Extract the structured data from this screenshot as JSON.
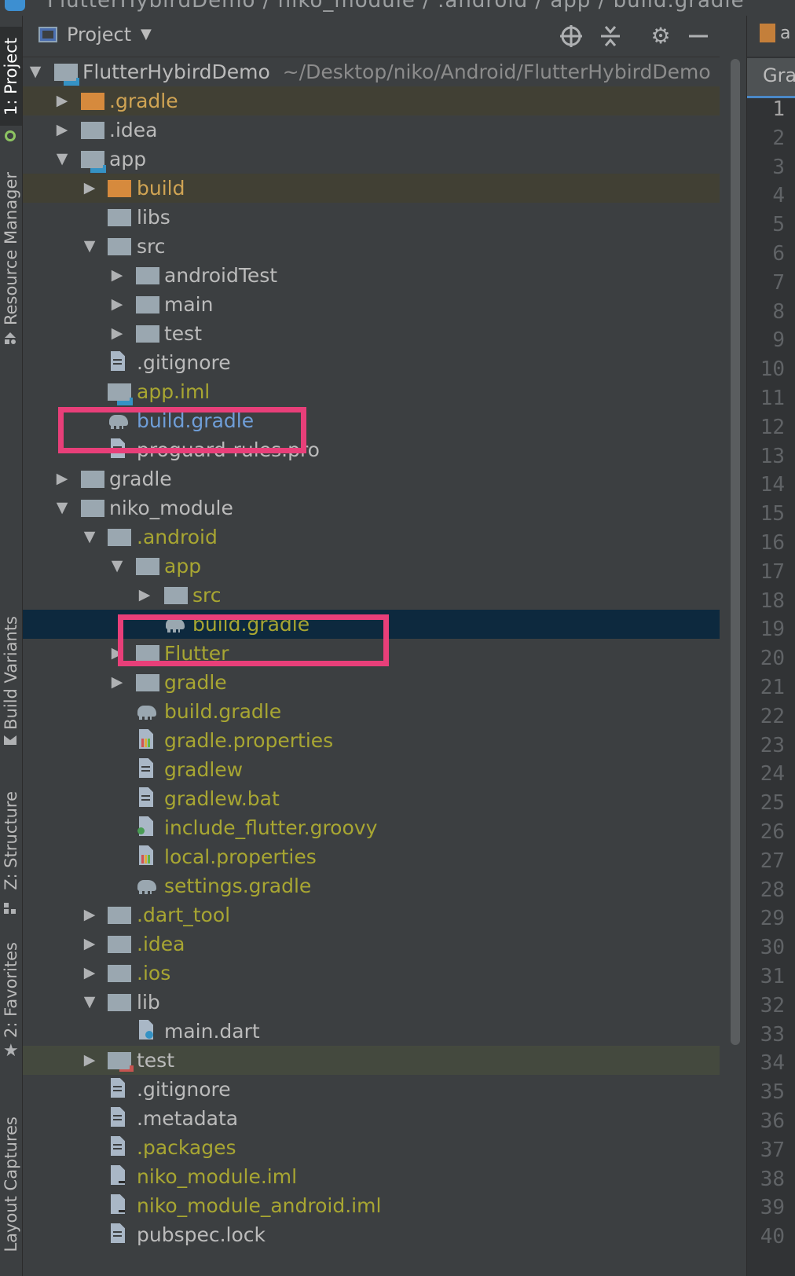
{
  "breadcrumb": {
    "text": "FlutterHybirdDemo / niko_module / .android / app / build.gradle"
  },
  "left_strip": {
    "tabs": [
      {
        "label": "1: Project",
        "active": true
      },
      {
        "label": "Resource Manager"
      },
      {
        "label": "Build Variants"
      },
      {
        "label": "Z: Structure"
      },
      {
        "label": "2: Favorites"
      },
      {
        "label": "Layout Captures"
      }
    ]
  },
  "project_header": {
    "title": "Project",
    "dropdown_icon": "triangle-down-icon",
    "tools": [
      "locate-icon",
      "collapse-all-icon",
      "gear-icon",
      "minimize-icon"
    ]
  },
  "tree": {
    "root": {
      "name": "FlutterHybirdDemo",
      "path": "~/Desktop/niko/Android/FlutterHybirdDemo"
    },
    "items": [
      {
        "label": ".gradle"
      },
      {
        "label": ".idea"
      },
      {
        "label": "app"
      },
      {
        "label": "build"
      },
      {
        "label": "libs"
      },
      {
        "label": "src"
      },
      {
        "label": "androidTest"
      },
      {
        "label": "main"
      },
      {
        "label": "test"
      },
      {
        "label": ".gitignore"
      },
      {
        "label": "app.iml"
      },
      {
        "label": "build.gradle"
      },
      {
        "label": "proguard-rules.pro"
      },
      {
        "label": "gradle"
      },
      {
        "label": "niko_module"
      },
      {
        "label": ".android"
      },
      {
        "label": "app"
      },
      {
        "label": "src"
      },
      {
        "label": "build.gradle"
      },
      {
        "label": "Flutter"
      },
      {
        "label": "gradle"
      },
      {
        "label": "build.gradle"
      },
      {
        "label": "gradle.properties"
      },
      {
        "label": "gradlew"
      },
      {
        "label": "gradlew.bat"
      },
      {
        "label": "include_flutter.groovy"
      },
      {
        "label": "local.properties"
      },
      {
        "label": "settings.gradle"
      },
      {
        "label": ".dart_tool"
      },
      {
        "label": ".idea"
      },
      {
        "label": ".ios"
      },
      {
        "label": "lib"
      },
      {
        "label": "main.dart"
      },
      {
        "label": "test"
      },
      {
        "label": ".gitignore"
      },
      {
        "label": ".metadata"
      },
      {
        "label": ".packages"
      },
      {
        "label": "niko_module.iml"
      },
      {
        "label": "niko_module_android.iml"
      },
      {
        "label": "pubspec.lock"
      }
    ]
  },
  "editor": {
    "file_tab_partial": "a",
    "tool_tab_partial": "Gra",
    "current_line": 1,
    "line_numbers": [
      "1",
      "2",
      "3",
      "4",
      "5",
      "6",
      "7",
      "8",
      "9",
      "10",
      "11",
      "12",
      "13",
      "14",
      "15",
      "16",
      "17",
      "18",
      "19",
      "20",
      "21",
      "22",
      "23",
      "24",
      "25",
      "26",
      "27",
      "28",
      "29",
      "30",
      "31",
      "32",
      "33",
      "34",
      "35",
      "36",
      "37",
      "38",
      "39",
      "40"
    ]
  },
  "colors": {
    "background": "#3c3f41",
    "selection": "#0d293e",
    "highlight_box": "#e83f79",
    "excluded_text": "#d0a454",
    "ignored_text": "#a8a632",
    "modified_text": "#6f9ed8"
  }
}
